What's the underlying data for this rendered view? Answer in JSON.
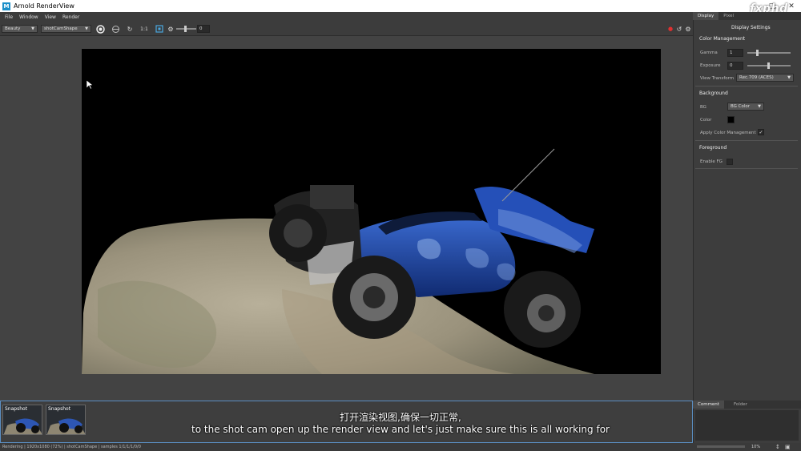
{
  "window": {
    "title": "Arnold RenderView",
    "icon_letter": "M"
  },
  "menu": [
    "File",
    "Window",
    "View",
    "Render"
  ],
  "toolbar": {
    "aov_select": "Beauty",
    "camera_select": "shotCamShape",
    "ratio_label": "1:1",
    "exposure_value": "0"
  },
  "side_tabs": [
    "Display",
    "Pixel"
  ],
  "display_settings": {
    "header": "Display Settings",
    "color_management": {
      "title": "Color Management",
      "gamma_label": "Gamma",
      "gamma_value": "1",
      "exposure_label": "Exposure",
      "exposure_value": "0",
      "view_transform_label": "View Transform",
      "view_transform_value": "Rec.709 (ACES)"
    },
    "background": {
      "title": "Background",
      "bg_label": "BG",
      "bg_value": "BG Color",
      "color_label": "Color",
      "color_value": "#000000",
      "apply_cm_label": "Apply Color Management",
      "apply_cm_checked": true
    },
    "foreground": {
      "title": "Foreground",
      "enable_fg_label": "Enable FG",
      "enable_fg_checked": false
    }
  },
  "snapshots": [
    {
      "label": "Snapshot"
    },
    {
      "label": "Snapshot"
    }
  ],
  "bottom_tabs": [
    "Comment",
    "Folder"
  ],
  "status": "Rendering | 1920x1080 (72%) | shotCamShape | samples 1/1/1/1/0/0",
  "zoom": "10%",
  "subtitles": {
    "zh": "打开渲染视图,确保一切正常,",
    "en": "to the shot cam open up the render view and let's just make sure this is all working for"
  },
  "watermark": "fxphd",
  "colors": {
    "accent": "#1b8fc9",
    "stop_red": "#e03030",
    "car_blue": "#1a3f9c"
  }
}
